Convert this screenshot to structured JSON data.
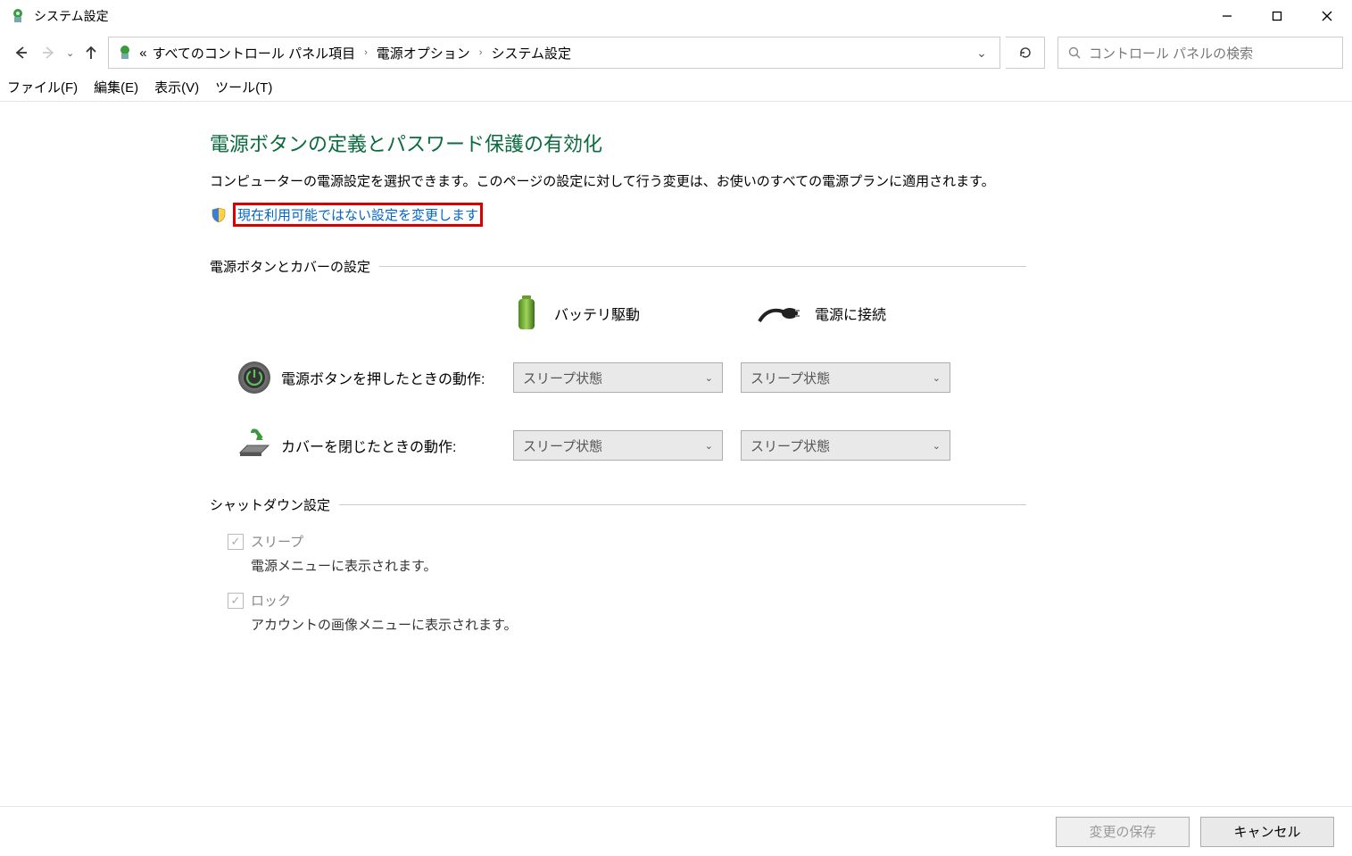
{
  "window": {
    "title": "システム設定"
  },
  "breadcrumb": {
    "prefix": "«",
    "items": [
      "すべてのコントロール パネル項目",
      "電源オプション",
      "システム設定"
    ]
  },
  "search": {
    "placeholder": "コントロール パネルの検索"
  },
  "menu": {
    "file": "ファイル(F)",
    "edit": "編集(E)",
    "view": "表示(V)",
    "tool": "ツール(T)"
  },
  "page": {
    "title": "電源ボタンの定義とパスワード保護の有効化",
    "desc": "コンピューターの電源設定を選択できます。このページの設定に対して行う変更は、お使いのすべての電源プランに適用されます。",
    "admin_link": "現在利用可能ではない設定を変更します"
  },
  "sections": {
    "buttons_cover": "電源ボタンとカバーの設定",
    "shutdown": "シャットダウン設定"
  },
  "columns": {
    "battery": "バッテリ駆動",
    "plugged": "電源に接続"
  },
  "rows": {
    "power_button": {
      "label": "電源ボタンを押したときの動作:",
      "battery_value": "スリープ状態",
      "plugged_value": "スリープ状態"
    },
    "lid_close": {
      "label": "カバーを閉じたときの動作:",
      "battery_value": "スリープ状態",
      "plugged_value": "スリープ状態"
    }
  },
  "shutdown_settings": [
    {
      "title": "スリープ",
      "desc": "電源メニューに表示されます。",
      "checked": true
    },
    {
      "title": "ロック",
      "desc": "アカウントの画像メニューに表示されます。",
      "checked": true
    }
  ],
  "footer": {
    "save": "変更の保存",
    "cancel": "キャンセル"
  }
}
